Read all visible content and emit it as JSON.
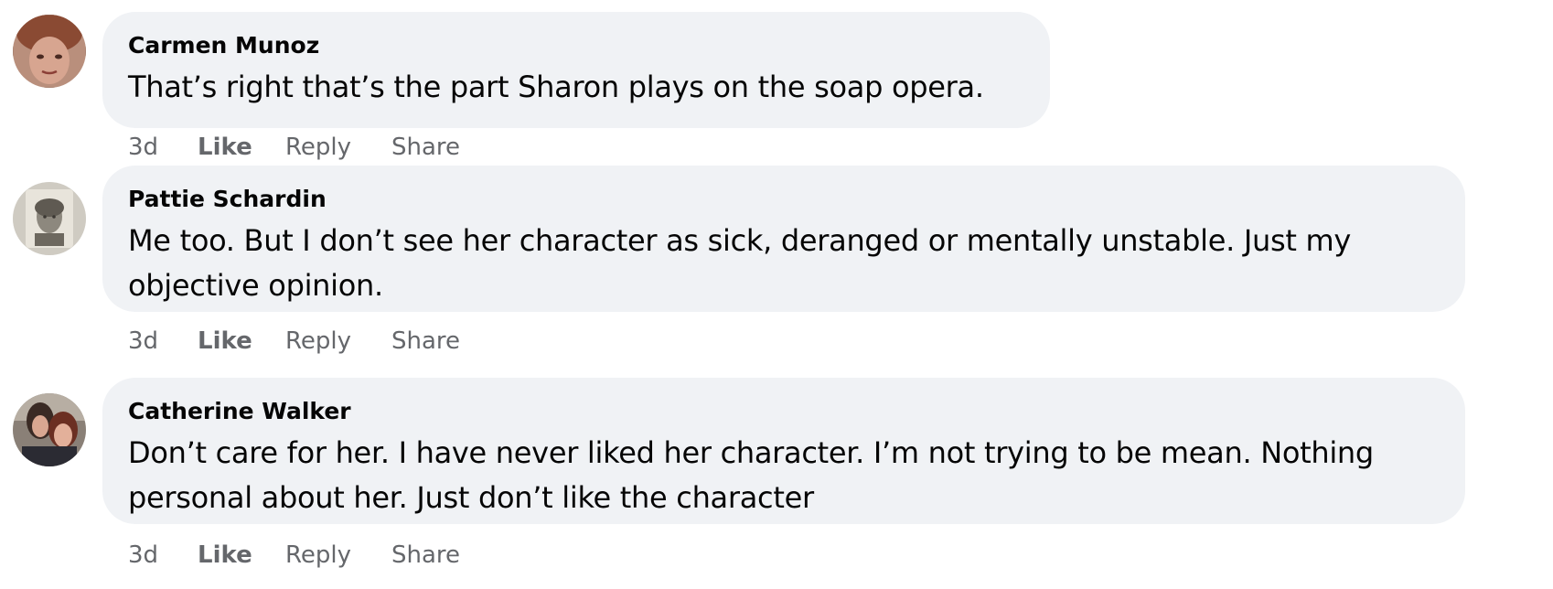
{
  "comments": [
    {
      "author": "Carmen Munoz",
      "text": "That’s right that’s the part Sharon plays on the soap opera.",
      "timestamp": "3d",
      "like_label": "Like",
      "reply_label": "Reply",
      "share_label": "Share",
      "avatar": "profile-photo-avatar"
    },
    {
      "author": "Pattie Schardin",
      "text": "Me too. But I don’t see her character as sick, deranged or mentally unstable. Just my objective opinion.",
      "timestamp": "3d",
      "like_label": "Like",
      "reply_label": "Reply",
      "share_label": "Share",
      "avatar": "profile-photo-avatar"
    },
    {
      "author": "Catherine Walker",
      "text": "Don’t care for her. I have never liked her character. I’m not trying to be mean. Nothing personal about her. Just don’t like the character",
      "timestamp": "3d",
      "like_label": "Like",
      "reply_label": "Reply",
      "share_label": "Share",
      "avatar": "profile-photo-avatar"
    }
  ],
  "colors": {
    "bubble_background": "#f0f2f5",
    "author_text": "#050505",
    "body_text": "#050505",
    "action_text": "#65676b"
  }
}
